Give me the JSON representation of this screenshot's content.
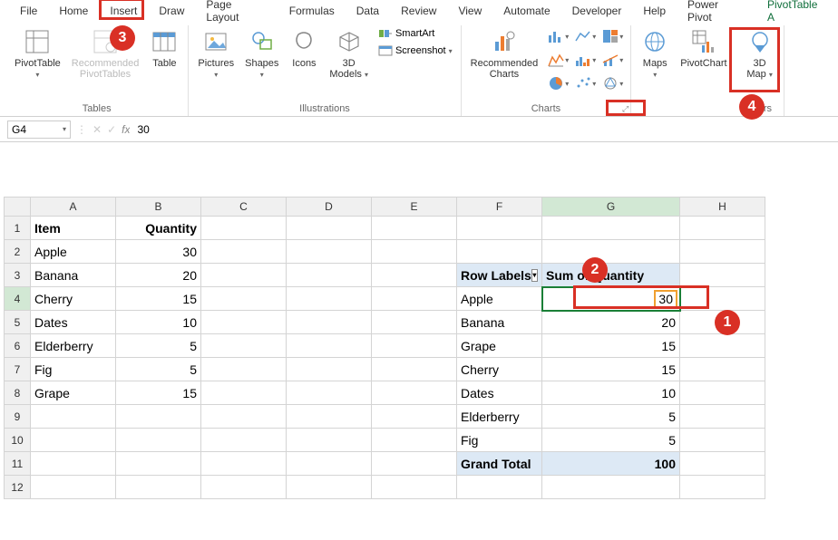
{
  "menu": [
    "File",
    "Home",
    "Insert",
    "Draw",
    "Page Layout",
    "Formulas",
    "Data",
    "Review",
    "View",
    "Automate",
    "Developer",
    "Help",
    "Power Pivot",
    "PivotTable A"
  ],
  "ribbon": {
    "tables": {
      "pivottable": "PivotTable",
      "recommended": "Recommended\nPivotTables",
      "table": "Table",
      "label": "Tables"
    },
    "illus": {
      "pictures": "Pictures",
      "shapes": "Shapes",
      "icons": "Icons",
      "models": "3D\nModels",
      "smartart": "SmartArt",
      "screenshot": "Screenshot",
      "label": "Illustrations"
    },
    "charts": {
      "recommended": "Recommended\nCharts",
      "label": "Charts"
    },
    "maps": "Maps",
    "pivotchart": "PivotChart",
    "map3d": "3D\nMap",
    "tours": "Tours"
  },
  "namebox": "G4",
  "formula": "30",
  "cols": [
    "A",
    "B",
    "C",
    "D",
    "E",
    "F",
    "G",
    "H"
  ],
  "rows": [
    "1",
    "2",
    "3",
    "4",
    "5",
    "6",
    "7",
    "8",
    "9",
    "10",
    "11",
    "12"
  ],
  "dataA": {
    "header": "Item",
    "items": [
      "Apple",
      "Banana",
      "Cherry",
      "Dates",
      "Elderberry",
      "Fig",
      "Grape"
    ]
  },
  "dataB": {
    "header": "Quantity",
    "items": [
      "30",
      "20",
      "15",
      "10",
      "5",
      "5",
      "15"
    ]
  },
  "pivot": {
    "rowlabel": "Row Labels",
    "sumheader": "Sum of Quantity",
    "rows": [
      {
        "label": "Apple",
        "val": "30"
      },
      {
        "label": "Banana",
        "val": "20"
      },
      {
        "label": "Grape",
        "val": "15"
      },
      {
        "label": "Cherry",
        "val": "15"
      },
      {
        "label": "Dates",
        "val": "10"
      },
      {
        "label": "Elderberry",
        "val": "5"
      },
      {
        "label": "Fig",
        "val": "5"
      }
    ],
    "total": {
      "label": "Grand Total",
      "val": "100"
    }
  },
  "badges": {
    "b1": "1",
    "b2": "2",
    "b3": "3",
    "b4": "4"
  }
}
